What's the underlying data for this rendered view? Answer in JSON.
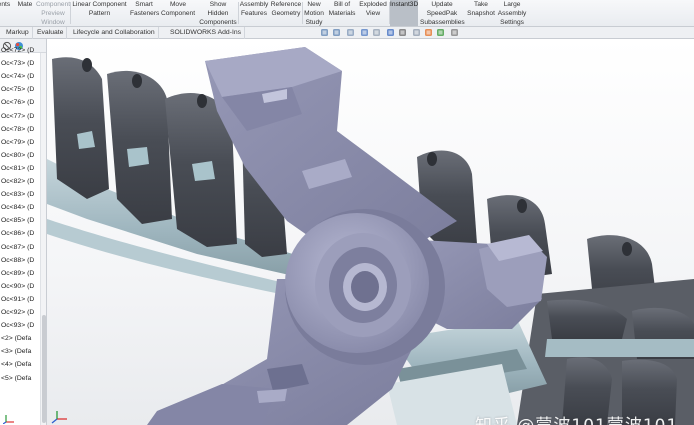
{
  "ribbon": {
    "buttons": [
      {
        "label": "nents",
        "state": "normal"
      },
      {
        "label": "Mate",
        "state": "normal"
      },
      {
        "label": "Component Preview Window",
        "state": "disabled"
      },
      {
        "label": "Linear Component Pattern",
        "state": "normal"
      },
      {
        "label": "Smart Fasteners",
        "state": "normal"
      },
      {
        "label": "Move Component",
        "state": "normal"
      },
      {
        "label": "Show Hidden Components",
        "state": "normal"
      },
      {
        "label": "Assembly Features",
        "state": "normal"
      },
      {
        "label": "Reference Geometry",
        "state": "normal"
      },
      {
        "label": "New Motion Study",
        "state": "normal"
      },
      {
        "label": "Bill of Materials",
        "state": "normal"
      },
      {
        "label": "Exploded View",
        "state": "normal"
      },
      {
        "label": "Instant3D",
        "state": "active"
      },
      {
        "label": "Update SpeedPak Subassemblies",
        "state": "normal"
      },
      {
        "label": "Take Snapshot",
        "state": "normal"
      },
      {
        "label": "Large Assembly Settings",
        "state": "normal"
      }
    ]
  },
  "tabs": [
    "Markup",
    "Evaluate",
    "Lifecycle and Collaboration",
    "SOLIDWORKS Add-Ins"
  ],
  "heads_up_toolbar": {
    "icons": [
      "zoom-to-fit-icon",
      "zoom-area-icon",
      "previous-view-icon",
      "section-view-icon",
      "dynamic-annotation-icon",
      "view-orientation-icon",
      "display-style-icon",
      "hide-show-items-icon",
      "edit-appearance-icon",
      "apply-scene-icon",
      "view-settings-icon"
    ]
  },
  "feature_tree": {
    "items": [
      "Oc<72> (D",
      "Oc<73> (D",
      "Oc<74> (D",
      "Oc<75> (D",
      "Oc<76> (D",
      "Oc<77> (D",
      "Oc<78> (D",
      "Oc<79> (D",
      "Oc<80> (D",
      "Oc<81> (D",
      "Oc<82> (D",
      "Oc<83> (D",
      "Oc<84> (D",
      "Oc<85> (D",
      "Oc<86> (D",
      "Oc<87> (D",
      "Oc<88> (D",
      "Oc<89> (D",
      "Oc<90> (D",
      "Oc<91> (D",
      "Oc<92> (D",
      "Oc<93> (D",
      "<2> (Defa",
      "<3> (Defa",
      "<4> (Defa",
      "<5> (Defa"
    ]
  },
  "viewport": {
    "watermark": "知乎 @蒙波101蒙波101",
    "colors": {
      "part_lavender": "#8e90ae",
      "part_light": "#b4b6d0",
      "part_dark": "#565a6e",
      "chain_link": "#4f535b",
      "chain_pin": "#a9c3cb",
      "background": "#ffffff"
    }
  }
}
